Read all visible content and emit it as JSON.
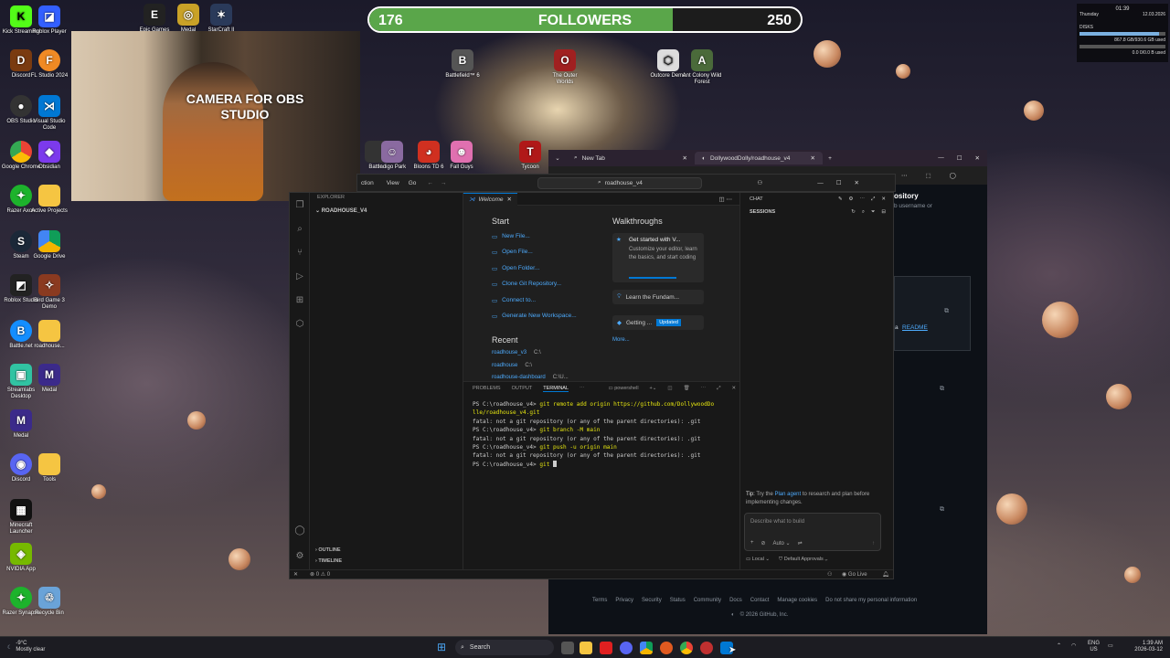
{
  "followers": {
    "current": "176",
    "label": "FOLLOWERS",
    "goal": "250",
    "progress": 0.704
  },
  "camera": {
    "label": "CAMERA FOR OBS STUDIO"
  },
  "stats_widget": {
    "time": "01:39",
    "day": "Thursday",
    "date": "12.03.2026",
    "disks_label": "DISKS",
    "disk_c": "867.8 GB/930.6 GB used",
    "disk_d": "0.0 0/0.0 B used",
    "disk_c_fill": 0.93,
    "disk_d_fill": 0.0
  },
  "desktop_icons": {
    "left_col1": [
      "Kick Streaming",
      "Discord",
      "OBS Studio",
      "Google Chrome",
      "Razer Axon",
      "Steam",
      "Roblox Studio",
      "Battle.net",
      "Streamlabs Desktop",
      "Medal",
      "Discord",
      "Minecraft Launcher",
      "NVIDIA App",
      "Razer Synapse"
    ],
    "left_col2": [
      "Roblox Player",
      "FL Studio 2024",
      "Visual Studio Code",
      "Obsidian",
      "Active Projects",
      "Google Drive",
      "Bird Game 3 Demo",
      "roadhouse...",
      "Medal",
      "Tools",
      "Recycle Bin"
    ],
    "top_row": [
      "Epic Games",
      "Medal",
      "StarCraft II"
    ],
    "mid_row": [
      "Battlefield™ 6",
      "The Outer Worlds",
      "Outcore Demo",
      "Ant Colony Wild Forest"
    ],
    "lower_row": [
      "Battle",
      "Indigo Park",
      "Bloons TD 6",
      "Fall Guys",
      "Tycoon"
    ]
  },
  "browser": {
    "tabs": [
      {
        "label": "New Tab"
      },
      {
        "label": "DollywoodDolly/roadhouse_v4"
      }
    ],
    "address": "roadhouse_v4",
    "github": {
      "heading_fragment": "ository",
      "hint_fragment": "b username or",
      "readme_prefix": "a",
      "readme_link": "README",
      "footer_links": [
        "Terms",
        "Privacy",
        "Security",
        "Status",
        "Community",
        "Docs",
        "Contact",
        "Manage cookies",
        "Do not share my personal information"
      ],
      "copyright": "© 2026 GitHub, Inc."
    }
  },
  "vscode": {
    "menu": [
      "ction",
      "View",
      "Go"
    ],
    "explorer_title": "EXPLORER",
    "folder": "ROADHOUSE_V4",
    "outline": "OUTLINE",
    "timeline": "TIMELINE",
    "editor_tab": "Welcome",
    "welcome": {
      "start_title": "Start",
      "start_items": [
        "New File...",
        "Open File...",
        "Open Folder...",
        "Clone Git Repository...",
        "Connect to...",
        "Generate New Workspace..."
      ],
      "recent_title": "Recent",
      "recent": [
        {
          "name": "roadhouse_v3",
          "path": "C:\\"
        },
        {
          "name": "roadhouse",
          "path": "C:\\"
        },
        {
          "name": "roadhouse-dashboard",
          "path": "C:\\U..."
        }
      ],
      "walk_title": "Walkthroughs",
      "walk_card_title": "Get started with V...",
      "walk_card_desc": "Customize your editor, learn the basics, and start coding",
      "walk_items": [
        "Learn the Fundam...",
        "Getting ..."
      ],
      "walk_badge": "Updated",
      "more": "More..."
    },
    "panel_tabs": [
      "PROBLEMS",
      "OUTPUT",
      "TERMINAL"
    ],
    "shell": "powershell",
    "terminal_lines": [
      {
        "p": "PS C:\\roadhouse_v4> ",
        "c": "git remote add origin https://github.com/DollywoodDo"
      },
      {
        "p": "",
        "c": "lle/roadhouse_v4.git"
      },
      {
        "p": "fatal: not a git repository (or any of the parent directories): .git",
        "c": ""
      },
      {
        "p": "PS C:\\roadhouse_v4> ",
        "c": "git branch -M main"
      },
      {
        "p": "fatal: not a git repository (or any of the parent directories): .git",
        "c": ""
      },
      {
        "p": "PS C:\\roadhouse_v4> ",
        "c": "git push -u origin main"
      },
      {
        "p": "fatal: not a git repository (or any of the parent directories): .git",
        "c": ""
      },
      {
        "p": "PS C:\\roadhouse_v4> ",
        "c": "git "
      }
    ],
    "chat": {
      "title": "CHAT",
      "sessions": "SESSIONS",
      "tip_prefix": "Tip:",
      "tip_text1": "Try the",
      "tip_link": "Plan agent",
      "tip_text2": "to research and plan before implementing changes.",
      "input_placeholder": "Describe what to build",
      "mode": "Auto",
      "local": "Local",
      "approvals": "Default Approvals"
    },
    "status": {
      "errors": "0",
      "warnings": "0",
      "golive": "Go Live"
    },
    "search_text": "roadhouse_v4"
  },
  "taskbar": {
    "weather_temp": "-9°C",
    "weather_desc": "Mostly clear",
    "search": "Search",
    "lang": "ENG",
    "region": "US",
    "time": "1:39 AM",
    "date": "2026-03-12"
  }
}
